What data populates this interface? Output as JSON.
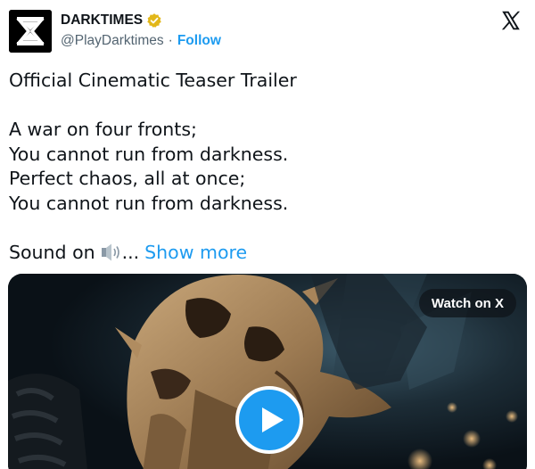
{
  "author": {
    "display_name": "DARKTIMES",
    "handle": "@PlayDarktimes",
    "separator": "·",
    "follow_label": "Follow",
    "avatar_icon": "hourglass-x-logo-icon",
    "verified_icon": "gold-verified-badge-icon",
    "verified_color": "#e2b719"
  },
  "platform_icon": "x-logo-icon",
  "tweet": {
    "title": "Official Cinematic Teaser Trailer",
    "lines": [
      "A war on four fronts;",
      "You cannot run from darkness.",
      "Perfect chaos, all at once;",
      "You cannot run from darkness."
    ],
    "sound_text": "Sound on",
    "ellipsis": "...",
    "show_more": "Show more",
    "sound_icon": "speaker-icon"
  },
  "media": {
    "watch_label": "Watch on X",
    "play_icon": "play-icon",
    "accent": "#1d9bf0"
  },
  "colors": {
    "text": "#0f1419",
    "secondary": "#536471",
    "link": "#1d9bf0"
  }
}
